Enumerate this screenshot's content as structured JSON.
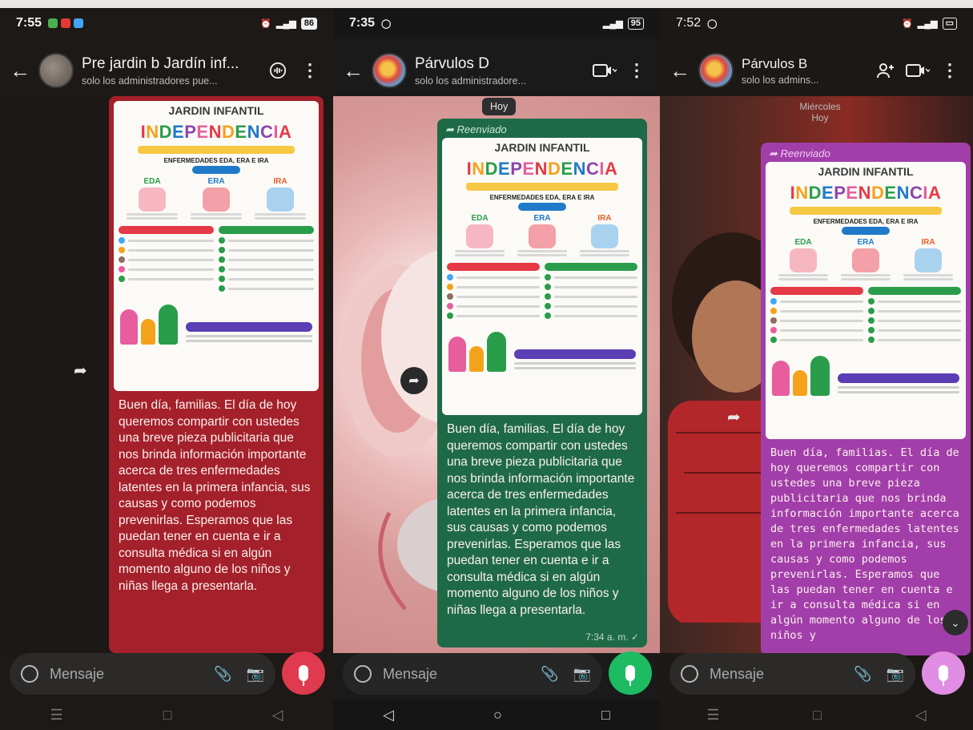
{
  "screens": [
    {
      "status": {
        "time": "7:55",
        "battery": "86"
      },
      "header": {
        "title": "Pre jardin b Jardín inf...",
        "subtitle": "solo los administradores pue..."
      },
      "poster": {
        "top": "JARDIN INFANTIL",
        "main": "INDEPENDENCIA",
        "sub": "ENFERMEDADES EDA, ERA E IRA",
        "cols": [
          "EDA",
          "ERA",
          "IRA"
        ]
      },
      "message": "Buen día, familias. El día de hoy queremos compartir con ustedes una breve pieza publicitaria que nos brinda información importante acerca de tres enfermedades latentes en la primera infancia, sus causas y como podemos prevenirlas. Esperamos que las puedan tener en cuenta e ir a consulta médica si en algún momento alguno de los niños y niñas llega a presentarla.",
      "input_placeholder": "Mensaje"
    },
    {
      "status": {
        "time": "7:35",
        "battery": "95"
      },
      "header": {
        "title": "Párvulos D",
        "subtitle": "solo los administradore..."
      },
      "date_chip": "Hoy",
      "forwarded_label": "Reenviado",
      "poster": {
        "top": "JARDIN INFANTIL",
        "main": "INDEPENDENCIA",
        "sub": "ENFERMEDADES EDA, ERA E IRA",
        "cols": [
          "EDA",
          "ERA",
          "IRA"
        ]
      },
      "message": "Buen día, familias. El día de hoy queremos compartir con ustedes una breve pieza publicitaria que nos brinda información importante acerca de tres enfermedades latentes en la primera infancia, sus causas y como podemos prevenirlas. Esperamos que las puedan tener en cuenta e ir a consulta médica si en algún momento alguno de los niños y niñas llega a presentarla.",
      "time": "7:34 a. m.",
      "input_placeholder": "Mensaje"
    },
    {
      "status": {
        "time": "7:52",
        "battery": ""
      },
      "header": {
        "title": "Párvulos B",
        "subtitle": "solo los admins..."
      },
      "day_label": "Miércoles",
      "day_label2": "Hoy",
      "forwarded_label": "Reenviado",
      "poster": {
        "top": "JARDIN INFANTIL",
        "main": "INDEPENDENCIA",
        "sub": "ENFERMEDADES EDA, ERA E IRA",
        "cols": [
          "EDA",
          "ERA",
          "IRA"
        ]
      },
      "message": "Buen día, familias. El día de hoy queremos compartir con ustedes una breve pieza publicitaria que nos brinda información importante acerca de tres enfermedades latentes en la primera infancia, sus causas y como podemos prevenirlas. Esperamos que las puedan tener en cuenta e ir a consulta médica si en algún momento alguno de los niños y",
      "input_placeholder": "Mensaje"
    }
  ],
  "colors": {
    "bubble_red": "#a4202a",
    "bubble_green": "#1e6a48",
    "bubble_purple": "#a23ea9",
    "mic_red": "#e03a4e",
    "mic_green": "#1dbb62",
    "mic_pink": "#e08ee3"
  },
  "icons": [
    "back-arrow-icon",
    "video-call-icon",
    "add-person-icon",
    "more-options-icon",
    "forward-icon",
    "emoji-icon",
    "attach-icon",
    "camera-icon",
    "mic-icon",
    "chevron-down-icon"
  ]
}
